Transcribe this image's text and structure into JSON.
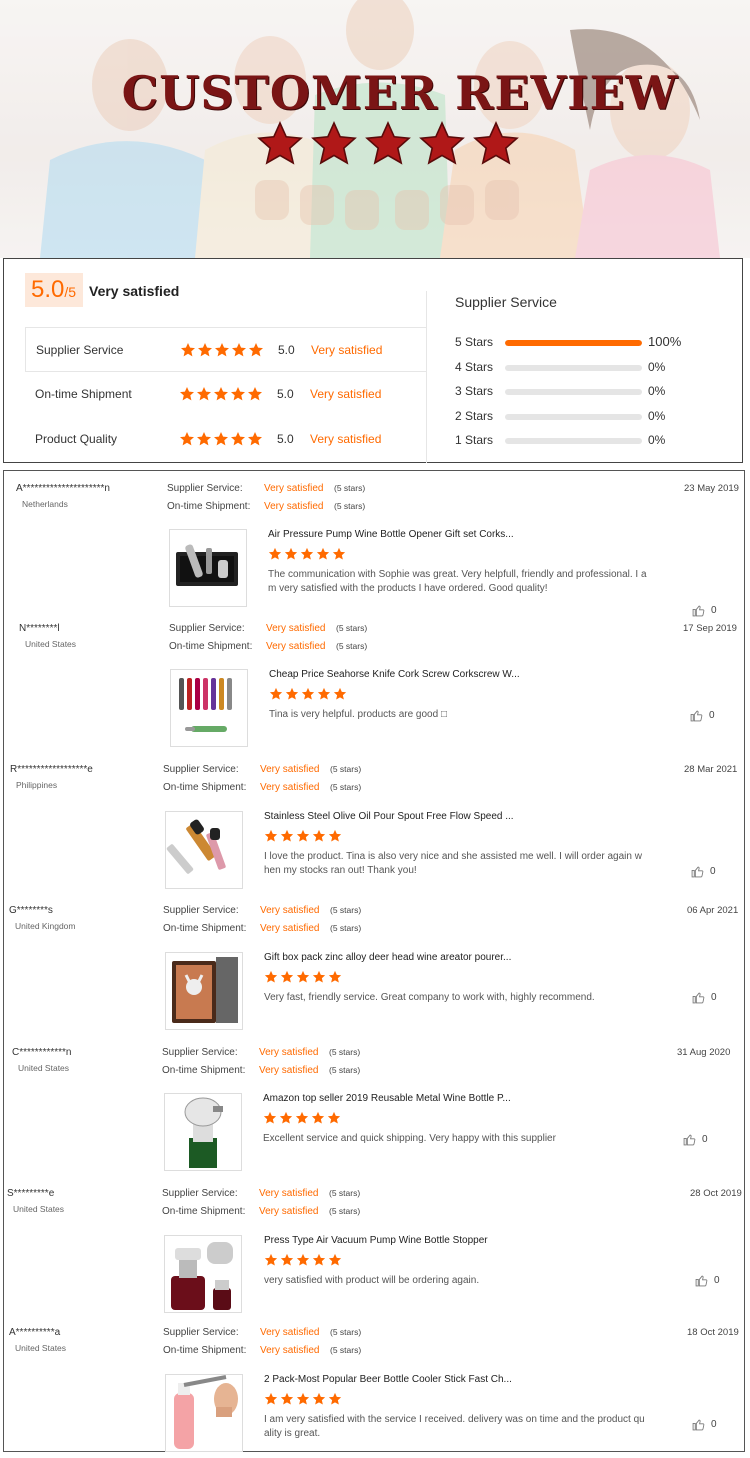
{
  "banner": {
    "title": "CUSTOMER REVIEW",
    "star_count": 5
  },
  "summary": {
    "score": "5.0",
    "score_suffix": "/5",
    "overall_label": "Very satisfied",
    "ratings": [
      {
        "label": "Supplier Service",
        "value": "5.0",
        "stars": 5,
        "satisfaction": "Very satisfied"
      },
      {
        "label": "On-time Shipment",
        "value": "5.0",
        "stars": 5,
        "satisfaction": "Very satisfied"
      },
      {
        "label": "Product Quality",
        "value": "5.0",
        "stars": 5,
        "satisfaction": "Very satisfied"
      }
    ],
    "distribution_title": "Supplier Service",
    "distribution": [
      {
        "label": "5 Stars",
        "percent": 100,
        "percent_label": "100%"
      },
      {
        "label": "4 Stars",
        "percent": 0,
        "percent_label": "0%"
      },
      {
        "label": "3 Stars",
        "percent": 0,
        "percent_label": "0%"
      },
      {
        "label": "2 Stars",
        "percent": 0,
        "percent_label": "0%"
      },
      {
        "label": "1 Stars",
        "percent": 0,
        "percent_label": "0%"
      }
    ]
  },
  "reviews": {
    "supplier_label": "Supplier Service:",
    "shipment_label": "On-time Shipment:",
    "items": [
      {
        "name": "A*********************n",
        "country": "Netherlands",
        "supplier": "Very satisfied",
        "supplier_stars": "(5 stars)",
        "shipment": "Very satisfied",
        "shipment_stars": "(5 stars)",
        "date": "23 May 2019",
        "product": "Air Pressure Pump Wine Bottle Opener Gift set Corks...",
        "rating": 5,
        "text": "The communication with Sophie was great. Very helpfull, friendly and professional. I am very satisfied with the products I have ordered. Good quality!",
        "likes": "0",
        "image": "wine-gift-set"
      },
      {
        "name": "N********l",
        "country": "United States",
        "supplier": "Very satisfied",
        "supplier_stars": "(5 stars)",
        "shipment": "Very satisfied",
        "shipment_stars": "(5 stars)",
        "date": "17 Sep 2019",
        "product": "Cheap Price Seahorse Knife Cork Screw Corkscrew W...",
        "rating": 5,
        "text": "Tina is  very helpful. products are good □",
        "likes": "0",
        "image": "corkscrews"
      },
      {
        "name": "R******************e",
        "country": "Philippines",
        "supplier": "Very satisfied",
        "supplier_stars": "(5 stars)",
        "shipment": "Very satisfied",
        "shipment_stars": "(5 stars)",
        "date": "28 Mar 2021",
        "product": "Stainless Steel Olive Oil Pour Spout Free Flow Speed ...",
        "rating": 5,
        "text": "I love the product. Tina is also very nice and she assisted me well. I will order again when my stocks ran out! Thank you!",
        "likes": "0",
        "image": "pour-spouts"
      },
      {
        "name": "G********s",
        "country": "United Kingdom",
        "supplier": "Very satisfied",
        "supplier_stars": "(5 stars)",
        "shipment": "Very satisfied",
        "shipment_stars": "(5 stars)",
        "date": "06 Apr 2021",
        "product": "Gift box pack zinc alloy deer head wine areator pourer...",
        "rating": 5,
        "text": "Very fast, friendly service. Great company to work with, highly recommend.",
        "likes": "0",
        "image": "deer-gift-box"
      },
      {
        "name": "C************n",
        "country": "United States",
        "supplier": "Very satisfied",
        "supplier_stars": "(5 stars)",
        "shipment": "Very satisfied",
        "shipment_stars": "(5 stars)",
        "date": "31 Aug 2020",
        "product": "Amazon top seller 2019 Reusable Metal Wine Bottle P...",
        "rating": 5,
        "text": "Excellent service and quick shipping. Very happy with this supplier",
        "likes": "0",
        "image": "bottle-stopper"
      },
      {
        "name": "S*********e",
        "country": "United States",
        "supplier": "Very satisfied",
        "supplier_stars": "(5 stars)",
        "shipment": "Very satisfied",
        "shipment_stars": "(5 stars)",
        "date": "28 Oct 2019",
        "product": "Press Type Air Vacuum Pump Wine Bottle Stopper",
        "rating": 5,
        "text": "very satisfied with product will be ordering again.",
        "likes": "0",
        "image": "vacuum-stopper"
      },
      {
        "name": "A**********a",
        "country": "United States",
        "supplier": "Very satisfied",
        "supplier_stars": "(5 stars)",
        "shipment": "Very satisfied",
        "shipment_stars": "(5 stars)",
        "date": "18 Oct 2019",
        "product": "2 Pack-Most Popular Beer Bottle Cooler Stick Fast Ch...",
        "rating": 5,
        "text": "I am very satisfied with the service I received. delivery was on time and the product quality is great.",
        "likes": "0",
        "image": "beer-cooler-stick"
      }
    ]
  },
  "colors": {
    "accent": "#ff6a00",
    "banner_title": "#7a1515",
    "banner_star": "#b01818",
    "badge_bg": "#fde8da"
  }
}
